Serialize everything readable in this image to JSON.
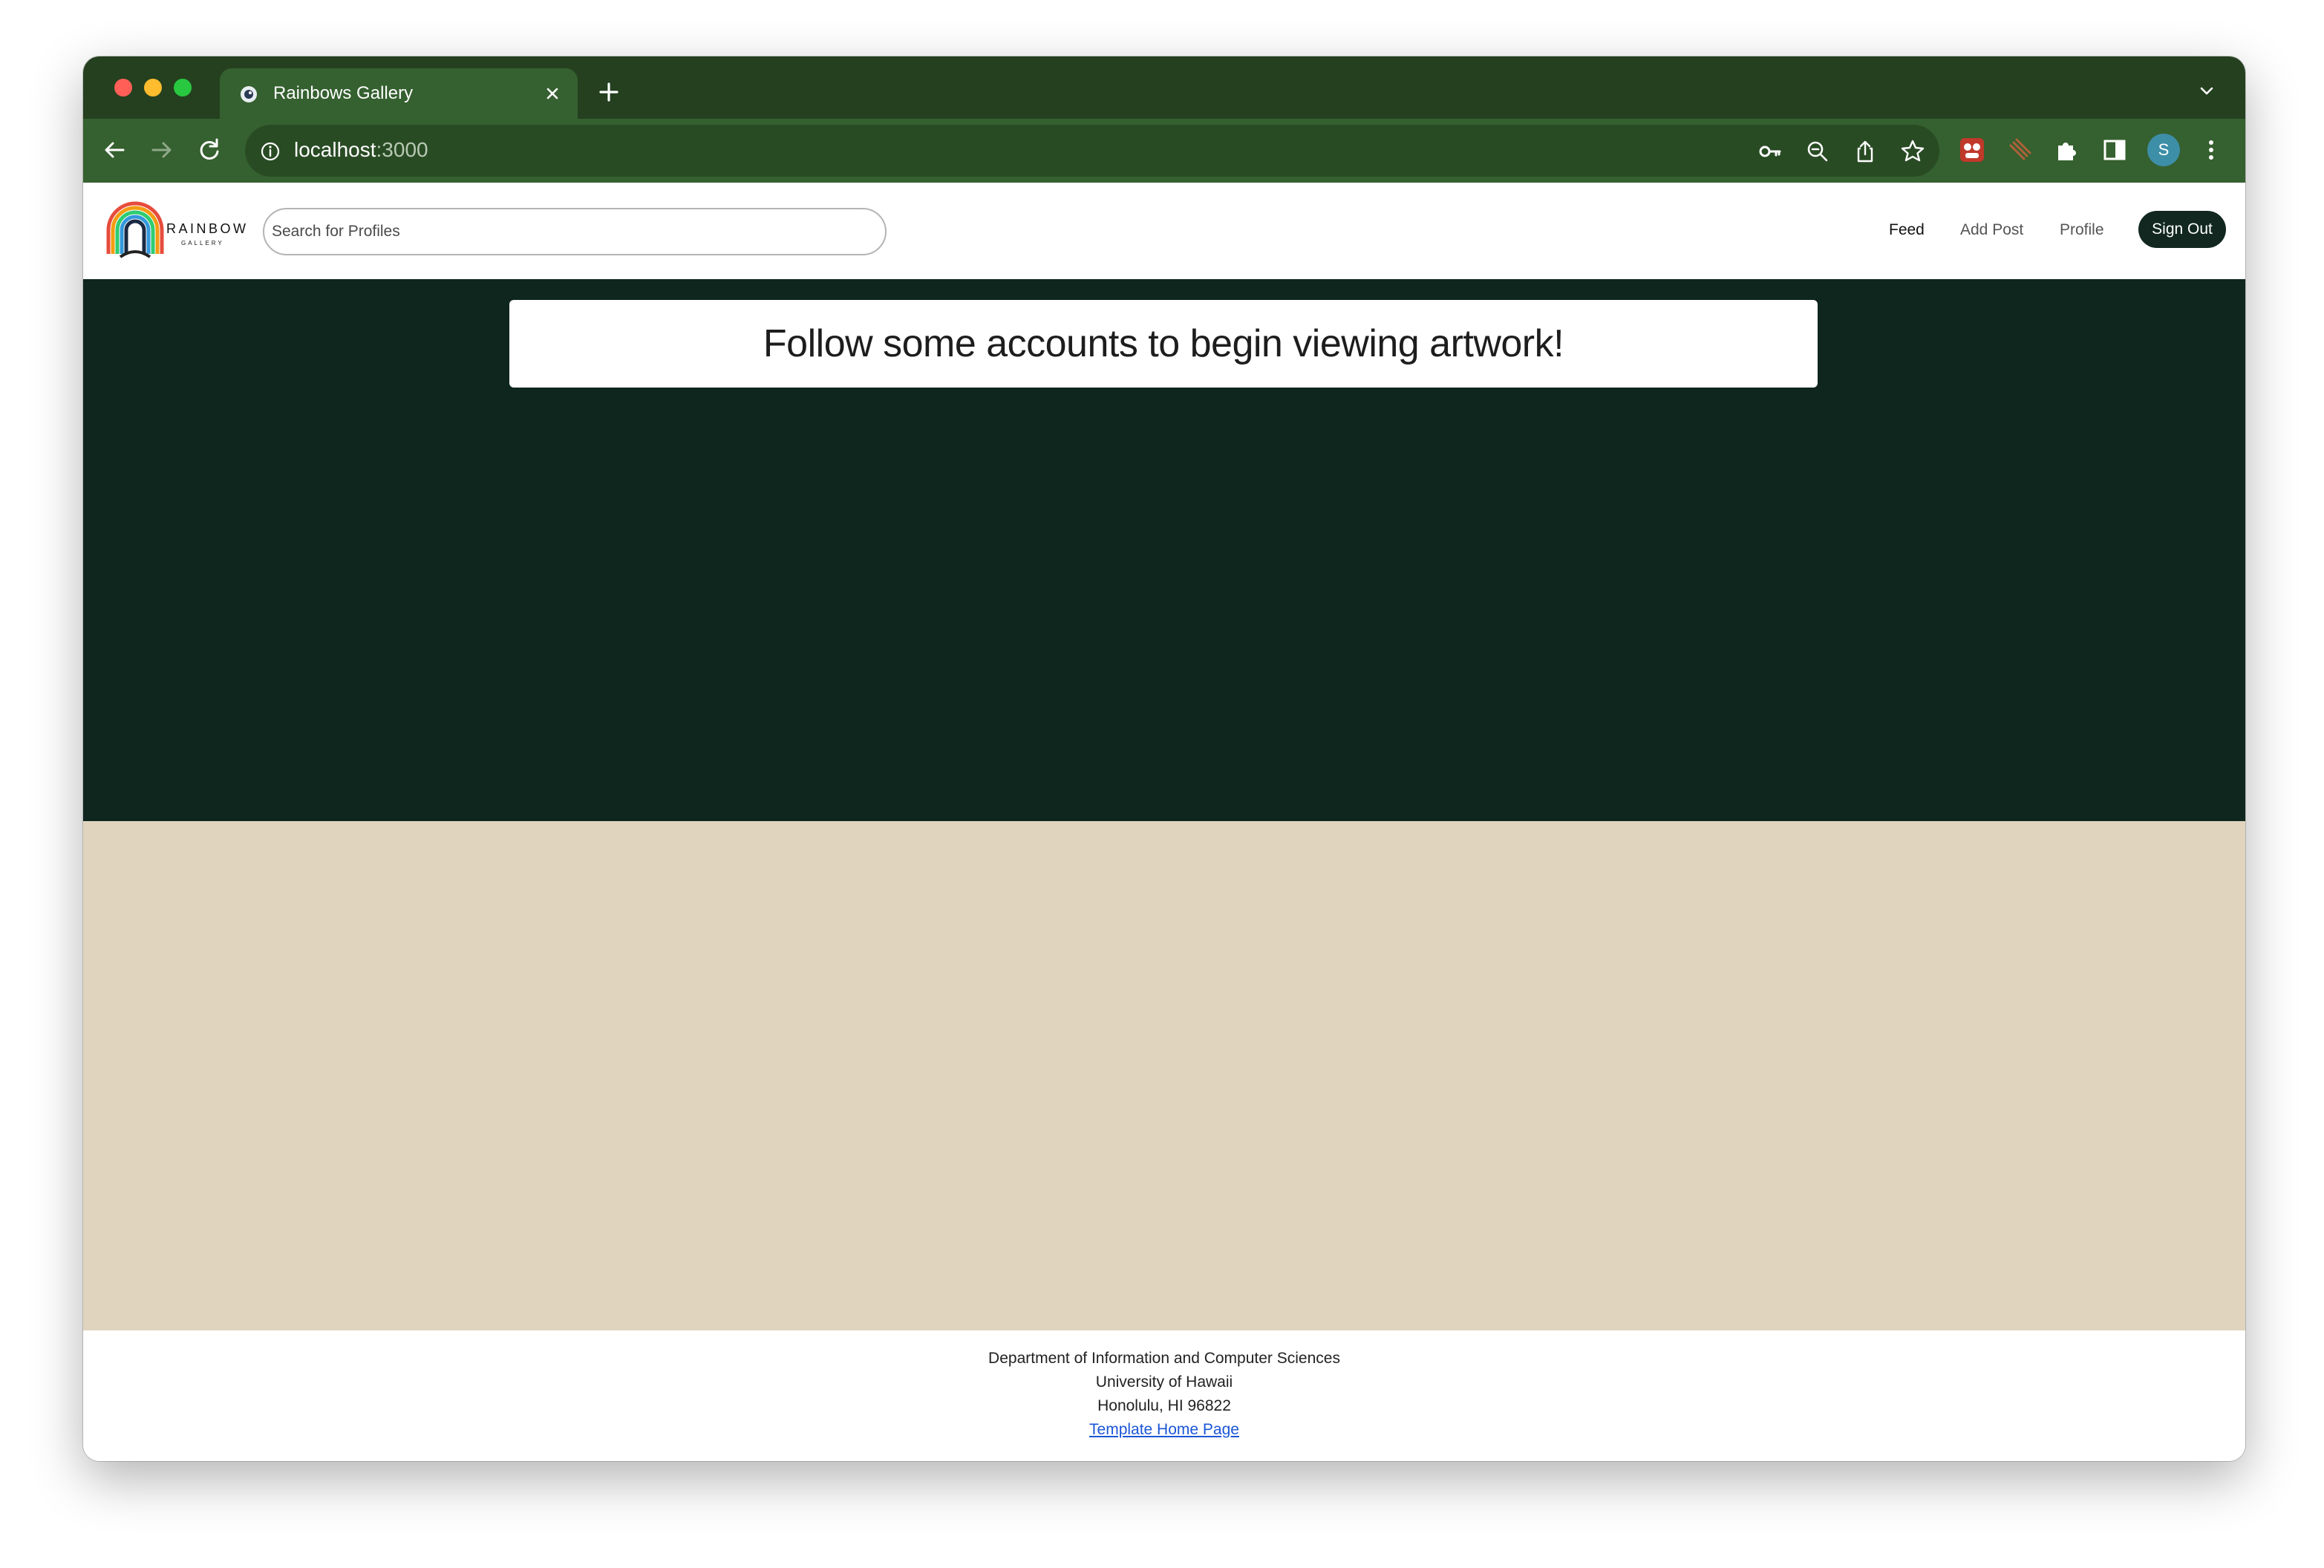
{
  "browser": {
    "tab_title": "Rainbows Gallery",
    "url_host": "localhost",
    "url_port": ":3000",
    "profile_initial": "S"
  },
  "navbar": {
    "logo_text": "RAINBOW",
    "logo_subtext": "GALLERY",
    "search_placeholder": "Search for Profiles",
    "links": {
      "feed": "Feed",
      "add_post": "Add Post",
      "profile": "Profile"
    },
    "sign_out_label": "Sign Out"
  },
  "main": {
    "message": "Follow some accounts to begin viewing artwork!"
  },
  "footer": {
    "line1": "Department of Information and Computer Sciences",
    "line2": "University of Hawaii",
    "line3": "Honolulu, HI 96822",
    "link_label": "Template Home Page"
  },
  "colors": {
    "chrome_dark": "#24401f",
    "chrome_tab": "#35602f",
    "hero_bg": "#0f261f",
    "tan_bg": "#e1d4be",
    "signout_bg": "#11271f",
    "link": "#1a56d6"
  }
}
